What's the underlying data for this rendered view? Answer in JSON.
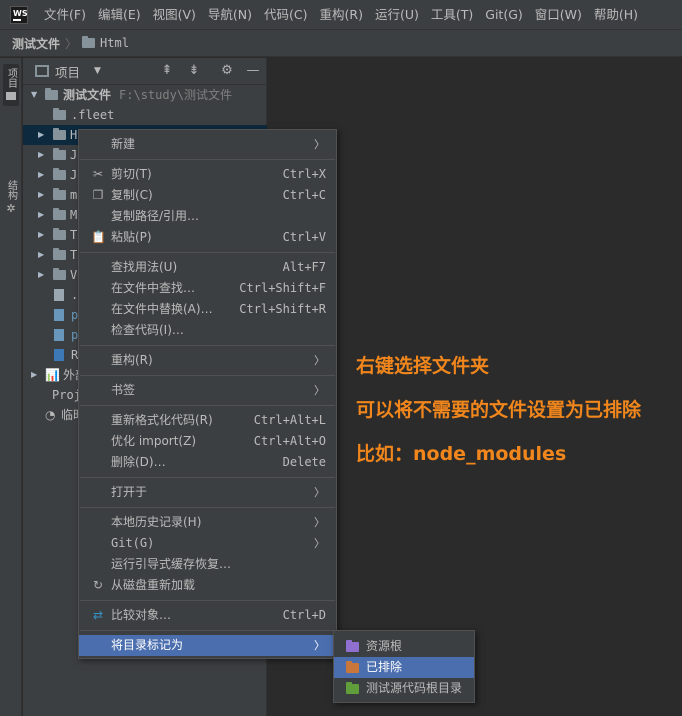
{
  "app": {
    "logo_text": "WS"
  },
  "menubar": {
    "items": [
      "文件(F)",
      "编辑(E)",
      "视图(V)",
      "导航(N)",
      "代码(C)",
      "重构(R)",
      "运行(U)",
      "工具(T)",
      "Git(G)",
      "窗口(W)",
      "帮助(H)"
    ]
  },
  "breadcrumb": {
    "project": "测试文件",
    "folder": "Html"
  },
  "left_stripe": {
    "project_label": "项目",
    "structure_label": "结构"
  },
  "panel": {
    "title": "项目",
    "tree": {
      "root_name": "测试文件",
      "root_path": "F:\\study\\测试文件",
      "fleet": ".fleet",
      "folders": [
        "H",
        "J",
        "J",
        "m",
        "M",
        "T",
        "T",
        "V"
      ],
      "files": [
        ".",
        "p",
        "p",
        "R"
      ],
      "external_libs": "外部",
      "project_item": "Proj",
      "scratch": "临时"
    }
  },
  "context_menu": {
    "new": "新建",
    "cut": "剪切(T)",
    "cut_shortcut": "Ctrl+X",
    "copy": "复制(C)",
    "copy_shortcut": "Ctrl+C",
    "copy_path": "复制路径/引用…",
    "paste": "粘贴(P)",
    "paste_shortcut": "Ctrl+V",
    "find_usages": "查找用法(U)",
    "find_usages_shortcut": "Alt+F7",
    "find_in_files": "在文件中查找…",
    "find_in_files_shortcut": "Ctrl+Shift+F",
    "replace_in_files": "在文件中替换(A)…",
    "replace_in_files_shortcut": "Ctrl+Shift+R",
    "inspect_code": "检查代码(I)…",
    "refactor": "重构(R)",
    "bookmarks": "书签",
    "reformat": "重新格式化代码(R)",
    "reformat_shortcut": "Ctrl+Alt+L",
    "optimize_imports": "优化 import(Z)",
    "optimize_imports_shortcut": "Ctrl+Alt+O",
    "delete": "删除(D)…",
    "delete_shortcut": "Delete",
    "open_in": "打开于",
    "local_history": "本地历史记录(H)",
    "git": "Git(G)",
    "repair_ide": "运行引导式缓存恢复…",
    "reload_from_disk": "从磁盘重新加载",
    "compare_with": "比较对象…",
    "compare_with_shortcut": "Ctrl+D",
    "mark_directory_as": "将目录标记为"
  },
  "submenu": {
    "sources_root": "资源根",
    "excluded": "已排除",
    "test_sources_root": "测试源代码根目录"
  },
  "annotations": {
    "line1": "右键选择文件夹",
    "line2": "可以将不需要的文件设置为已排除",
    "line3": "比如：node_modules"
  },
  "colors": {
    "accent_orange": "#f0861c",
    "selection_blue": "#4b6eaf",
    "folder_sources": "#8f6fd0",
    "folder_excluded": "#c9763a",
    "folder_test": "#5f9e3a"
  }
}
